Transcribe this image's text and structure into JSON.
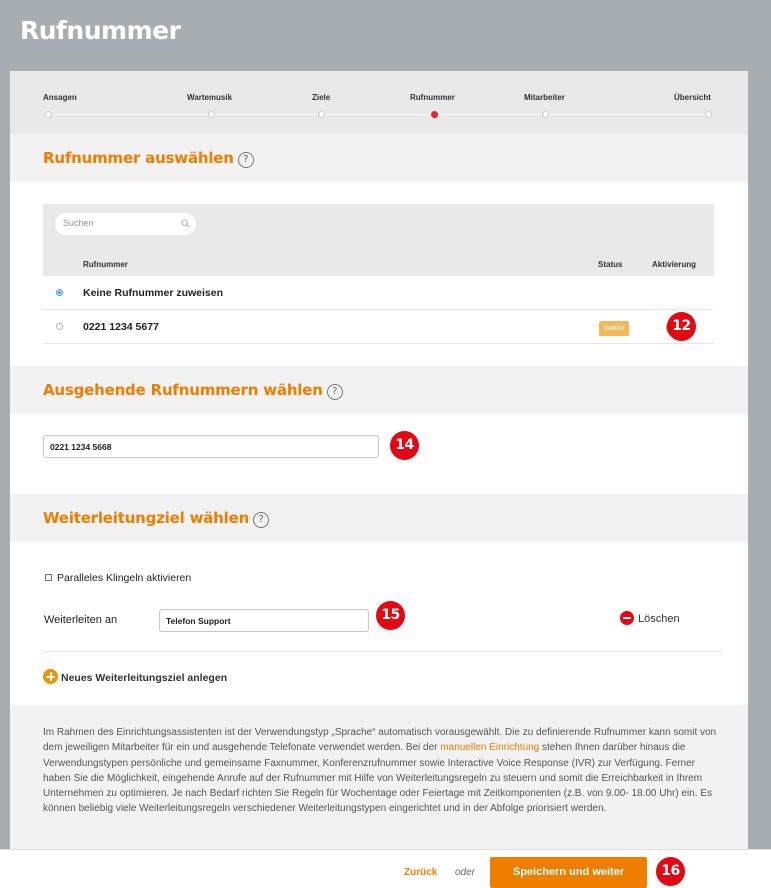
{
  "page": {
    "title": "Rufnummer"
  },
  "stepper": {
    "steps": [
      {
        "label": "Ansagen",
        "active": false
      },
      {
        "label": "Wartemusik",
        "active": false
      },
      {
        "label": "Ziele",
        "active": false
      },
      {
        "label": "Rufnummer",
        "active": true
      },
      {
        "label": "Mitarbeiter",
        "active": false
      },
      {
        "label": "Übersicht",
        "active": false
      }
    ]
  },
  "select_number": {
    "heading": "Rufnummer auswählen",
    "help": "?",
    "search_placeholder": "Suchen",
    "columns": {
      "number": "Rufnummer",
      "status": "Status",
      "activation": "Aktivierung"
    },
    "rows": [
      {
        "label": "Keine Rufnummer zuweisen",
        "selected": true,
        "status": "",
        "activation": ""
      },
      {
        "label": "0221 1234 5677",
        "selected": false,
        "status": "Inaktiv",
        "activation": "on"
      }
    ],
    "callout": "12"
  },
  "outgoing": {
    "heading": "Ausgehende Rufnummern wählen",
    "help": "?",
    "value": "0221 1234 5668",
    "callout": "14"
  },
  "forwarding": {
    "heading": "Weiterleitungziel wählen",
    "help": "?",
    "parallel_label": "Paralleles Klingeln aktivieren",
    "forward_label": "Weiterleiten an",
    "forward_value": "Telefon Support",
    "callout": "15",
    "delete_label": "Löschen",
    "new_target_label": "Neues Weiterleitungsziel anlegen"
  },
  "info": {
    "text_before_link": "Im Rahmen des Einrichtungsassistenten ist der Verwendungstyp „Sprache“ automatisch vorausgewählt. Die zu definierende Rufnummer kann somit von dem jeweiligen Mitarbeiter für ein und ausgehende Telefonate verwendet werden. Bei der ",
    "link_text": "manuellen Einrichtung",
    "text_after_link": " stehen Ihnen darüber hinaus die Verwendungstypen persönliche und gemeinsame Faxnummer, Konferenzrufnummer sowie Interactive Voice Response (IVR) zur Verfügung. Ferner haben Sie die Möglichkeit, eingehende Anrufe auf der Rufnummer mit Hilfe von Weiterleitungsregeln zu steuern und somit die Erreichbarkeit in Ihrem Unternehmen zu optimieren. Je nach Bedarf richten Sie Regeln für Wochentage oder Feiertage mit Zeitkomponenten (z.B. von 9.00- 18.00 Uhr) ein. Es können beliebig viele Weiterleitungsregeln verschiedener Weiterleitungstypen eingerichtet und in der Abfolge priorisiert werden."
  },
  "footer": {
    "back_label": "Zurück",
    "or_label": "oder",
    "save_label": "Speichern und weiter",
    "callout": "16"
  },
  "colors": {
    "accent": "#ef7d00",
    "callout": "#e30613",
    "active_step": "#e8242c",
    "toggle_on": "#86b739",
    "badge_inactive": "#f5b75c"
  }
}
